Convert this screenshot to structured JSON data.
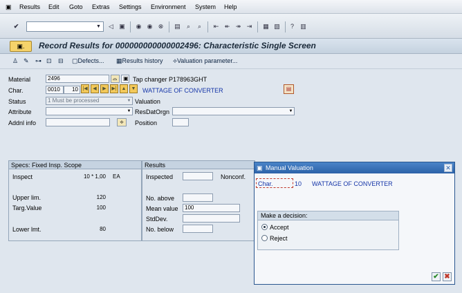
{
  "menubar": {
    "items": [
      "Results",
      "Edit",
      "Goto",
      "Extras",
      "Settings",
      "Environment",
      "System",
      "Help"
    ]
  },
  "title": "Record Results for 000000000000002496: Characteristic Single Screen",
  "app_toolbar": {
    "defects": "Defects...",
    "results_history": "Results history",
    "valuation_parameter": "Valuation parameter..."
  },
  "form": {
    "material_label": "Material",
    "material_value": "2496",
    "material_desc": "Tap changer P178963GHT",
    "char_label": "Char.",
    "char_num": "0010",
    "char_sub": "10",
    "char_desc": "WATTAGE OF CONVERTER",
    "status_label": "Status",
    "status_value": "1 Must be processed",
    "valuation_label": "Valuation",
    "attribute_label": "Attribute",
    "resdatorgn_label": "ResDatOrgn",
    "addnl_label": "Addnl info",
    "position_label": "Position"
  },
  "specs": {
    "header": "Specs: Fixed Insp. Scope",
    "inspect_label": "Inspect",
    "inspect_value": "10 * 1,00",
    "inspect_unit": "EA",
    "upper_label": "Upper lim.",
    "upper_value": "120",
    "targ_label": "Targ.Value",
    "targ_value": "100",
    "lower_label": "Lower lmt.",
    "lower_value": "80"
  },
  "results": {
    "header": "Results",
    "inspected_label": "Inspected",
    "nonconf_label": "Nonconf.",
    "no_above_label": "No. above",
    "mean_label": "Mean value",
    "mean_value": "100",
    "stddev_label": "StdDev.",
    "no_below_label": "No. below"
  },
  "dialog": {
    "title": "Manual Valuation",
    "char_label": "Char.",
    "char_num": "10",
    "char_desc": "WATTAGE OF CONVERTER",
    "decision_header": "Make a decision:",
    "accept": "Accept",
    "reject": "Reject",
    "selected": "Accept"
  },
  "colors": {
    "accent": "#2c62a8",
    "nav_yellow": "#f3c95a",
    "link_blue": "#1535a8"
  }
}
